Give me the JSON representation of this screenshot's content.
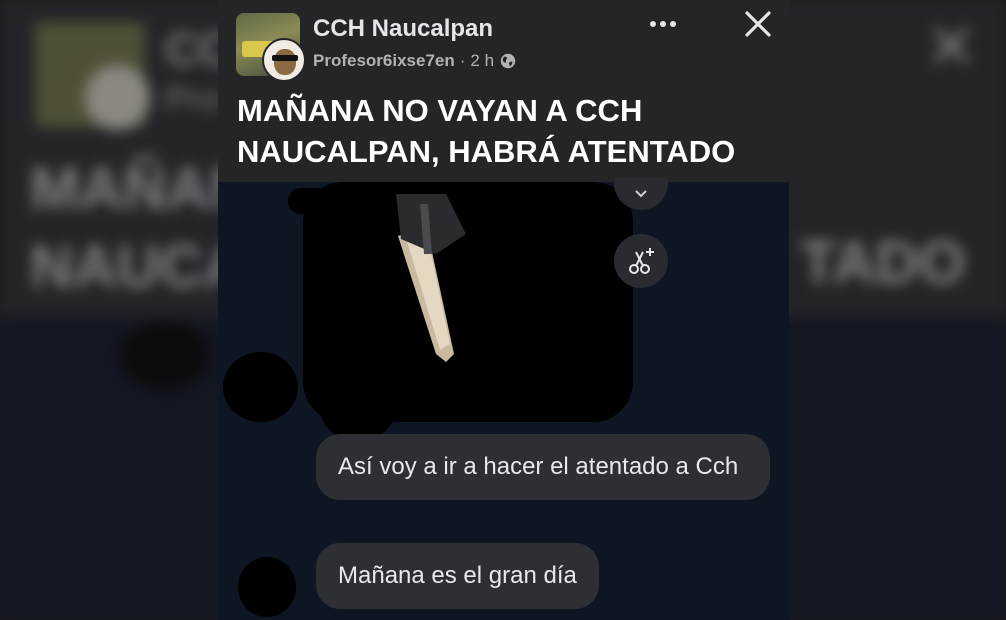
{
  "post": {
    "group_name": "CCH Naucalpan",
    "author": "Profesor6ixse7en",
    "time": "2 h",
    "separator": "·",
    "headline": "MAÑANA NO VAYAN A CCH NAUCALPAN, HABRÁ ATENTADO"
  },
  "background": {
    "title_fragment": "CC",
    "meta_fragment": "Pro",
    "headline_line1_left": "MAÑANA",
    "headline_line2_left": "NAUCA",
    "headline_line2_right": "TADO"
  },
  "icons": {
    "privacy": "globe-icon",
    "more": "more-dots-icon",
    "close": "close-icon",
    "scissors": "scissors-sparkle-icon"
  },
  "messages": [
    {
      "text": "Así voy a ir a hacer el atentado a Cch"
    },
    {
      "text": "Mañana es el gran día"
    }
  ],
  "colors": {
    "header_bg": "#242526",
    "media_bg": "#0e1523",
    "bubble_bg": "#2e2f34",
    "text_primary": "#ffffff",
    "text_secondary": "#b0b3b8"
  }
}
